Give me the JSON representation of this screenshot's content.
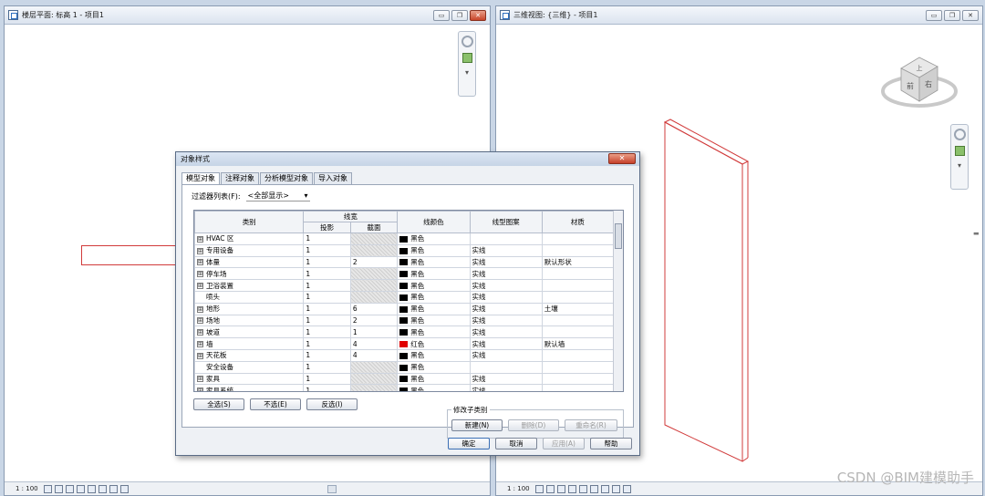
{
  "left_view": {
    "title": "楼层平面: 标高 1 - 项目1",
    "scale": "1 : 100"
  },
  "right_view": {
    "title": "三维视图: {三维} - 项目1",
    "scale": "1 : 100",
    "viewcube_faces": [
      "上",
      "前",
      "右"
    ]
  },
  "window_buttons": {
    "minimize": "▭",
    "restore": "❐",
    "close": "✕"
  },
  "dialog": {
    "title": "对象样式",
    "close": "✕",
    "tabs": [
      "模型对象",
      "注释对象",
      "分析模型对象",
      "导入对象"
    ],
    "filter_label": "过滤器列表(F):",
    "filter_value": "<全部显示>",
    "headers": {
      "category": "类别",
      "line_weight": "线宽",
      "projection": "投影",
      "cut": "截面",
      "line_color": "线颜色",
      "line_pattern": "线型图案",
      "material": "材质"
    },
    "rows": [
      {
        "expander": "⊞",
        "name": "HVAC 区",
        "proj": "1",
        "cut": "",
        "cut_hatched": true,
        "color_name": "黑色",
        "color": "#000000",
        "pattern": "",
        "material": ""
      },
      {
        "expander": "⊞",
        "name": "专用设备",
        "proj": "1",
        "cut": "",
        "cut_hatched": true,
        "color_name": "黑色",
        "color": "#000000",
        "pattern": "实线",
        "material": ""
      },
      {
        "expander": "⊞",
        "name": "体量",
        "proj": "1",
        "cut": "2",
        "cut_hatched": false,
        "color_name": "黑色",
        "color": "#000000",
        "pattern": "实线",
        "material": "默认形状"
      },
      {
        "expander": "⊞",
        "name": "停车场",
        "proj": "1",
        "cut": "",
        "cut_hatched": true,
        "color_name": "黑色",
        "color": "#000000",
        "pattern": "实线",
        "material": ""
      },
      {
        "expander": "⊞",
        "name": "卫浴装置",
        "proj": "1",
        "cut": "",
        "cut_hatched": true,
        "color_name": "黑色",
        "color": "#000000",
        "pattern": "实线",
        "material": ""
      },
      {
        "expander": "",
        "name": "喷头",
        "proj": "1",
        "cut": "",
        "cut_hatched": true,
        "color_name": "黑色",
        "color": "#000000",
        "pattern": "实线",
        "material": ""
      },
      {
        "expander": "⊞",
        "name": "地形",
        "proj": "1",
        "cut": "6",
        "cut_hatched": false,
        "color_name": "黑色",
        "color": "#000000",
        "pattern": "实线",
        "material": "土壤"
      },
      {
        "expander": "⊞",
        "name": "场地",
        "proj": "1",
        "cut": "2",
        "cut_hatched": false,
        "color_name": "黑色",
        "color": "#000000",
        "pattern": "实线",
        "material": ""
      },
      {
        "expander": "⊞",
        "name": "坡道",
        "proj": "1",
        "cut": "1",
        "cut_hatched": false,
        "color_name": "黑色",
        "color": "#000000",
        "pattern": "实线",
        "material": ""
      },
      {
        "expander": "⊞",
        "name": "墙",
        "proj": "1",
        "cut": "4",
        "cut_hatched": false,
        "color_name": "红色",
        "color": "#e00000",
        "pattern": "实线",
        "material": "默认墙"
      },
      {
        "expander": "⊞",
        "name": "天花板",
        "proj": "1",
        "cut": "4",
        "cut_hatched": false,
        "color_name": "黑色",
        "color": "#000000",
        "pattern": "实线",
        "material": ""
      },
      {
        "expander": "",
        "name": "安全设备",
        "proj": "1",
        "cut": "",
        "cut_hatched": true,
        "color_name": "黑色",
        "color": "#000000",
        "pattern": "",
        "material": ""
      },
      {
        "expander": "⊞",
        "name": "家具",
        "proj": "1",
        "cut": "",
        "cut_hatched": true,
        "color_name": "黑色",
        "color": "#000000",
        "pattern": "实线",
        "material": ""
      },
      {
        "expander": "⊞",
        "name": "家具系统",
        "proj": "1",
        "cut": "",
        "cut_hatched": true,
        "color_name": "黑色",
        "color": "#000000",
        "pattern": "实线",
        "material": ""
      }
    ],
    "buttons": {
      "select_all": "全选(S)",
      "select_none": "不选(E)",
      "invert": "反选(I)",
      "subcategory_group": "修改子类别",
      "new": "新建(N)",
      "delete": "删除(D)",
      "rename": "重命名(R)",
      "ok": "确定",
      "cancel": "取消",
      "apply": "应用(A)",
      "help": "帮助"
    }
  },
  "watermark": "CSDN @BIM建模助手"
}
